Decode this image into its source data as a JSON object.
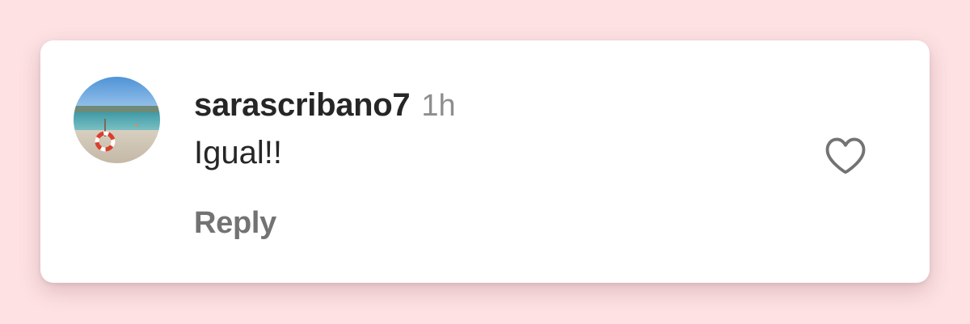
{
  "comment": {
    "username": "sarascribano7",
    "timestamp": "1h",
    "text": "Igual!!",
    "reply_label": "Reply",
    "like_icon": "heart-outline-icon",
    "avatar_description": "profile-photo"
  },
  "colors": {
    "page_background": "#fde1e3",
    "card_background": "#ffffff",
    "primary_text": "#262626",
    "secondary_text": "#8e8e8e",
    "reply_text": "#737373",
    "icon_stroke": "#737373"
  }
}
